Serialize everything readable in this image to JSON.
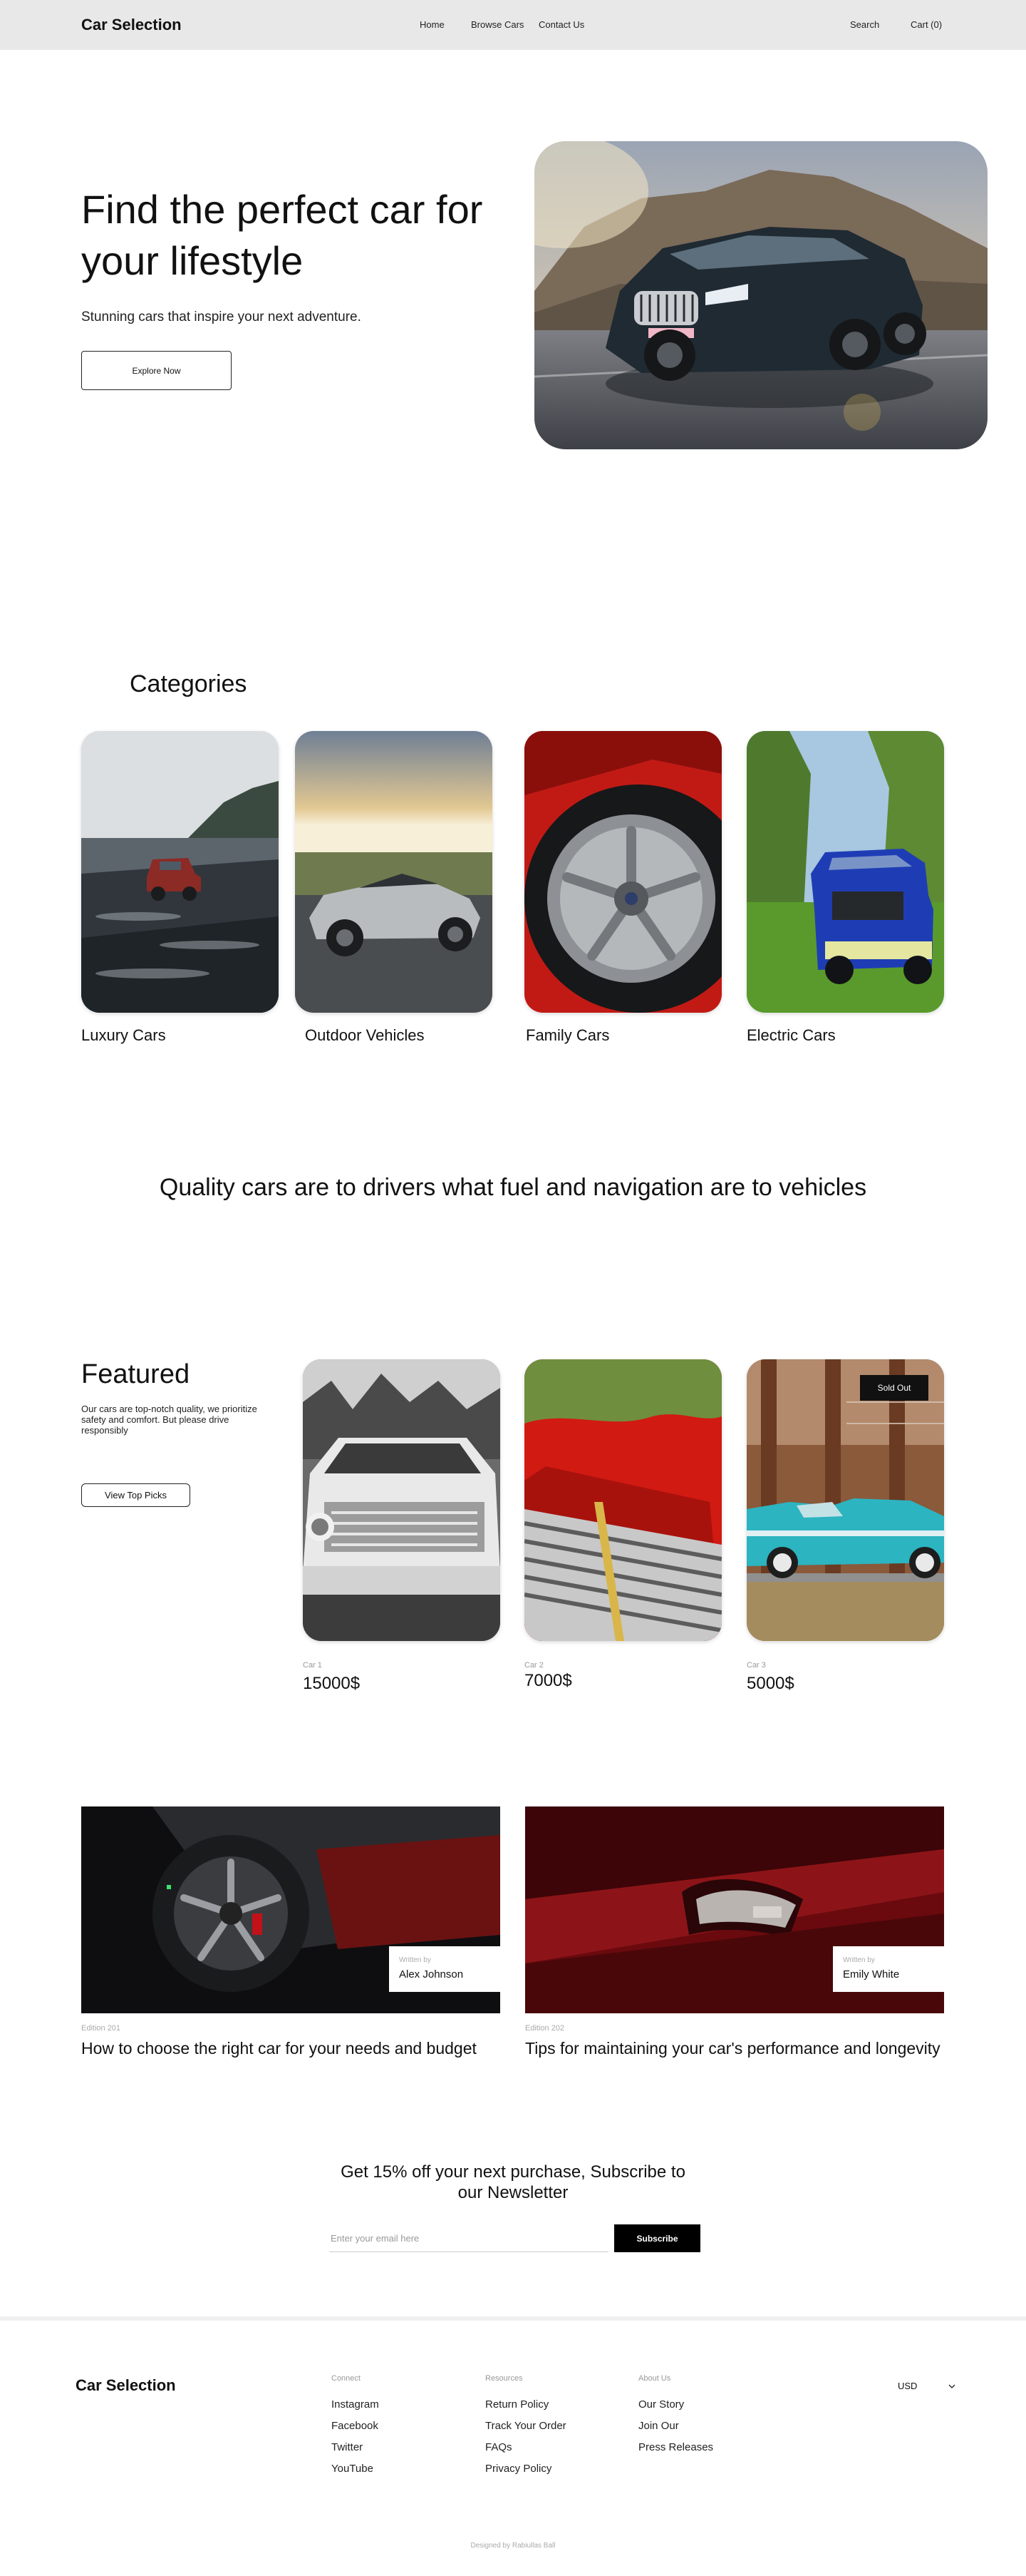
{
  "header": {
    "brand": "Car Selection",
    "nav": [
      "Home",
      "Browse Cars",
      "Contact Us"
    ],
    "search": "Search",
    "cart": "Cart (0)"
  },
  "hero": {
    "title": "Find the perfect car for your lifestyle",
    "subtitle": "Stunning cars that inspire your next adventure.",
    "cta": "Explore Now"
  },
  "categories": {
    "title": "Categories",
    "items": [
      {
        "label": "Luxury Cars"
      },
      {
        "label": "Outdoor Vehicles"
      },
      {
        "label": "Family Cars"
      },
      {
        "label": "Electric Cars"
      }
    ]
  },
  "quote": "Quality cars are to drivers what fuel and navigation are to vehicles",
  "featured": {
    "title": "Featured",
    "description": "Our cars are top-notch quality, we prioritize safety and comfort. But please drive responsibly",
    "cta": "View Top Picks",
    "items": [
      {
        "name": "Car 1",
        "price": "15000$",
        "badge": ""
      },
      {
        "name": "Car 2",
        "price": "7000$",
        "badge": ""
      },
      {
        "name": "Car 3",
        "price": "5000$",
        "badge": "Sold Out"
      }
    ]
  },
  "blog": {
    "written_by_label": "Written by",
    "posts": [
      {
        "author": "Alex Johnson",
        "edition": "Edition 201",
        "title": "How to choose the right car for your needs and budget"
      },
      {
        "author": "Emily White",
        "edition": "Edition 202",
        "title": "Tips for maintaining your car's performance and longevity"
      }
    ]
  },
  "newsletter": {
    "title": "Get 15% off your next purchase, Subscribe to our Newsletter",
    "placeholder": "Enter your email here",
    "button": "Subscribe"
  },
  "footer": {
    "brand": "Car Selection",
    "columns": [
      {
        "heading": "Connect",
        "links": [
          "Instagram",
          "Facebook",
          "Twitter",
          "YouTube"
        ]
      },
      {
        "heading": "Resources",
        "links": [
          "Return Policy",
          "Track Your Order",
          "FAQs",
          "Privacy Policy"
        ]
      },
      {
        "heading": "About Us",
        "links": [
          "Our Story",
          "Join Our",
          "Press Releases"
        ]
      }
    ],
    "currency": "USD",
    "credit": "Designed by Rabiullas Ball"
  }
}
